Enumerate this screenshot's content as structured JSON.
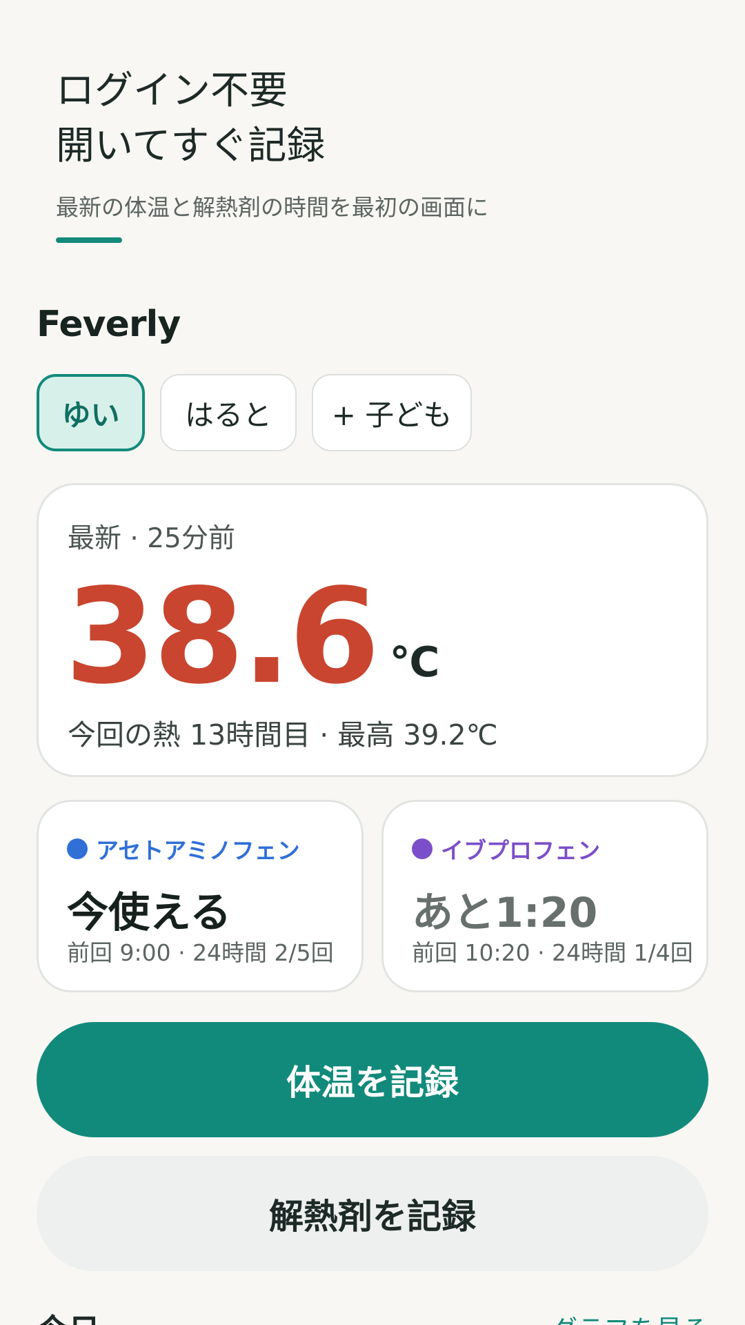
{
  "hero": {
    "title_line1": "ログイン不要",
    "title_line2": "開いてすぐ記録",
    "subtitle": "最新の体温と解熱剤の時間を最初の画面に"
  },
  "app": {
    "name": "Feverly"
  },
  "children": {
    "tabs": [
      {
        "label": "ゆい",
        "selected": true
      },
      {
        "label": "はると",
        "selected": false
      }
    ],
    "add_label": "+ 子ども"
  },
  "temperature": {
    "meta": "最新 · 25分前",
    "value": "38.6",
    "unit": "℃",
    "footer": "今回の熱 13時間目 · 最高 39.2℃"
  },
  "medicines": [
    {
      "name": "アセトアミノフェン",
      "status": "今使える",
      "detail": "前回 9:00 · 24時間 2/5回",
      "color": "#2f6fd6",
      "status_color": "#16211e"
    },
    {
      "name": "イブプロフェン",
      "status": "あと1:20",
      "detail": "前回 10:20 · 24時間 1/4回",
      "color": "#7b4fc9",
      "status_color": "#67706d"
    }
  ],
  "actions": {
    "record_temperature": "体温を記録",
    "record_medicine": "解熱剤を記録"
  },
  "bottom": {
    "section_title": "今日",
    "graph_link": "グラフを見る"
  },
  "colors": {
    "accent": "#118a7b",
    "fever": "#c9452f",
    "background": "#f8f7f3"
  }
}
